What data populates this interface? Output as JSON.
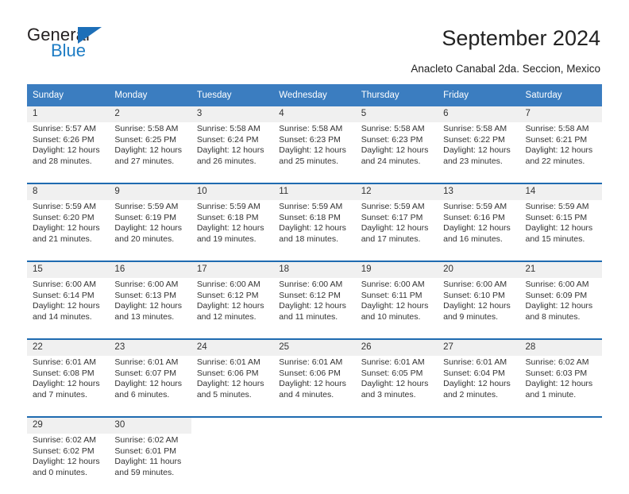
{
  "brand": {
    "name_top": "General",
    "name_bottom": "Blue",
    "triangle_color": "#1d6fb8",
    "blue_text_color": "#1d7cc4"
  },
  "header": {
    "title": "September 2024",
    "subtitle": "Anacleto Canabal 2da. Seccion, Mexico"
  },
  "theme": {
    "header_bg": "#3b7dc0",
    "week_separator": "#1f6bb0",
    "daynum_bg": "#f0f0f0",
    "cell_bg": "#ffffff"
  },
  "calendar": {
    "weekday_headers": [
      "Sunday",
      "Monday",
      "Tuesday",
      "Wednesday",
      "Thursday",
      "Friday",
      "Saturday"
    ],
    "weeks": [
      [
        {
          "day": "1",
          "sunrise": "Sunrise: 5:57 AM",
          "sunset": "Sunset: 6:26 PM",
          "daylight_1": "Daylight: 12 hours",
          "daylight_2": "and 28 minutes."
        },
        {
          "day": "2",
          "sunrise": "Sunrise: 5:58 AM",
          "sunset": "Sunset: 6:25 PM",
          "daylight_1": "Daylight: 12 hours",
          "daylight_2": "and 27 minutes."
        },
        {
          "day": "3",
          "sunrise": "Sunrise: 5:58 AM",
          "sunset": "Sunset: 6:24 PM",
          "daylight_1": "Daylight: 12 hours",
          "daylight_2": "and 26 minutes."
        },
        {
          "day": "4",
          "sunrise": "Sunrise: 5:58 AM",
          "sunset": "Sunset: 6:23 PM",
          "daylight_1": "Daylight: 12 hours",
          "daylight_2": "and 25 minutes."
        },
        {
          "day": "5",
          "sunrise": "Sunrise: 5:58 AM",
          "sunset": "Sunset: 6:23 PM",
          "daylight_1": "Daylight: 12 hours",
          "daylight_2": "and 24 minutes."
        },
        {
          "day": "6",
          "sunrise": "Sunrise: 5:58 AM",
          "sunset": "Sunset: 6:22 PM",
          "daylight_1": "Daylight: 12 hours",
          "daylight_2": "and 23 minutes."
        },
        {
          "day": "7",
          "sunrise": "Sunrise: 5:58 AM",
          "sunset": "Sunset: 6:21 PM",
          "daylight_1": "Daylight: 12 hours",
          "daylight_2": "and 22 minutes."
        }
      ],
      [
        {
          "day": "8",
          "sunrise": "Sunrise: 5:59 AM",
          "sunset": "Sunset: 6:20 PM",
          "daylight_1": "Daylight: 12 hours",
          "daylight_2": "and 21 minutes."
        },
        {
          "day": "9",
          "sunrise": "Sunrise: 5:59 AM",
          "sunset": "Sunset: 6:19 PM",
          "daylight_1": "Daylight: 12 hours",
          "daylight_2": "and 20 minutes."
        },
        {
          "day": "10",
          "sunrise": "Sunrise: 5:59 AM",
          "sunset": "Sunset: 6:18 PM",
          "daylight_1": "Daylight: 12 hours",
          "daylight_2": "and 19 minutes."
        },
        {
          "day": "11",
          "sunrise": "Sunrise: 5:59 AM",
          "sunset": "Sunset: 6:18 PM",
          "daylight_1": "Daylight: 12 hours",
          "daylight_2": "and 18 minutes."
        },
        {
          "day": "12",
          "sunrise": "Sunrise: 5:59 AM",
          "sunset": "Sunset: 6:17 PM",
          "daylight_1": "Daylight: 12 hours",
          "daylight_2": "and 17 minutes."
        },
        {
          "day": "13",
          "sunrise": "Sunrise: 5:59 AM",
          "sunset": "Sunset: 6:16 PM",
          "daylight_1": "Daylight: 12 hours",
          "daylight_2": "and 16 minutes."
        },
        {
          "day": "14",
          "sunrise": "Sunrise: 5:59 AM",
          "sunset": "Sunset: 6:15 PM",
          "daylight_1": "Daylight: 12 hours",
          "daylight_2": "and 15 minutes."
        }
      ],
      [
        {
          "day": "15",
          "sunrise": "Sunrise: 6:00 AM",
          "sunset": "Sunset: 6:14 PM",
          "daylight_1": "Daylight: 12 hours",
          "daylight_2": "and 14 minutes."
        },
        {
          "day": "16",
          "sunrise": "Sunrise: 6:00 AM",
          "sunset": "Sunset: 6:13 PM",
          "daylight_1": "Daylight: 12 hours",
          "daylight_2": "and 13 minutes."
        },
        {
          "day": "17",
          "sunrise": "Sunrise: 6:00 AM",
          "sunset": "Sunset: 6:12 PM",
          "daylight_1": "Daylight: 12 hours",
          "daylight_2": "and 12 minutes."
        },
        {
          "day": "18",
          "sunrise": "Sunrise: 6:00 AM",
          "sunset": "Sunset: 6:12 PM",
          "daylight_1": "Daylight: 12 hours",
          "daylight_2": "and 11 minutes."
        },
        {
          "day": "19",
          "sunrise": "Sunrise: 6:00 AM",
          "sunset": "Sunset: 6:11 PM",
          "daylight_1": "Daylight: 12 hours",
          "daylight_2": "and 10 minutes."
        },
        {
          "day": "20",
          "sunrise": "Sunrise: 6:00 AM",
          "sunset": "Sunset: 6:10 PM",
          "daylight_1": "Daylight: 12 hours",
          "daylight_2": "and 9 minutes."
        },
        {
          "day": "21",
          "sunrise": "Sunrise: 6:00 AM",
          "sunset": "Sunset: 6:09 PM",
          "daylight_1": "Daylight: 12 hours",
          "daylight_2": "and 8 minutes."
        }
      ],
      [
        {
          "day": "22",
          "sunrise": "Sunrise: 6:01 AM",
          "sunset": "Sunset: 6:08 PM",
          "daylight_1": "Daylight: 12 hours",
          "daylight_2": "and 7 minutes."
        },
        {
          "day": "23",
          "sunrise": "Sunrise: 6:01 AM",
          "sunset": "Sunset: 6:07 PM",
          "daylight_1": "Daylight: 12 hours",
          "daylight_2": "and 6 minutes."
        },
        {
          "day": "24",
          "sunrise": "Sunrise: 6:01 AM",
          "sunset": "Sunset: 6:06 PM",
          "daylight_1": "Daylight: 12 hours",
          "daylight_2": "and 5 minutes."
        },
        {
          "day": "25",
          "sunrise": "Sunrise: 6:01 AM",
          "sunset": "Sunset: 6:06 PM",
          "daylight_1": "Daylight: 12 hours",
          "daylight_2": "and 4 minutes."
        },
        {
          "day": "26",
          "sunrise": "Sunrise: 6:01 AM",
          "sunset": "Sunset: 6:05 PM",
          "daylight_1": "Daylight: 12 hours",
          "daylight_2": "and 3 minutes."
        },
        {
          "day": "27",
          "sunrise": "Sunrise: 6:01 AM",
          "sunset": "Sunset: 6:04 PM",
          "daylight_1": "Daylight: 12 hours",
          "daylight_2": "and 2 minutes."
        },
        {
          "day": "28",
          "sunrise": "Sunrise: 6:02 AM",
          "sunset": "Sunset: 6:03 PM",
          "daylight_1": "Daylight: 12 hours",
          "daylight_2": "and 1 minute."
        }
      ],
      [
        {
          "day": "29",
          "sunrise": "Sunrise: 6:02 AM",
          "sunset": "Sunset: 6:02 PM",
          "daylight_1": "Daylight: 12 hours",
          "daylight_2": "and 0 minutes."
        },
        {
          "day": "30",
          "sunrise": "Sunrise: 6:02 AM",
          "sunset": "Sunset: 6:01 PM",
          "daylight_1": "Daylight: 11 hours",
          "daylight_2": "and 59 minutes."
        },
        {
          "day": "",
          "sunrise": "",
          "sunset": "",
          "daylight_1": "",
          "daylight_2": ""
        },
        {
          "day": "",
          "sunrise": "",
          "sunset": "",
          "daylight_1": "",
          "daylight_2": ""
        },
        {
          "day": "",
          "sunrise": "",
          "sunset": "",
          "daylight_1": "",
          "daylight_2": ""
        },
        {
          "day": "",
          "sunrise": "",
          "sunset": "",
          "daylight_1": "",
          "daylight_2": ""
        },
        {
          "day": "",
          "sunrise": "",
          "sunset": "",
          "daylight_1": "",
          "daylight_2": ""
        }
      ]
    ]
  }
}
